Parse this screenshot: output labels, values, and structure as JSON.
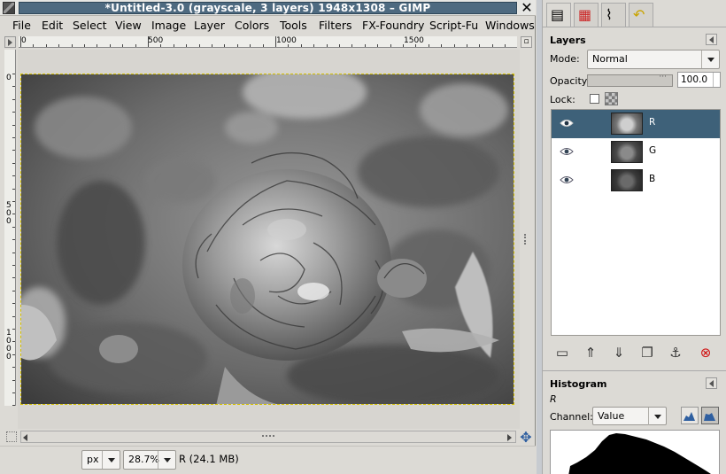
{
  "window": {
    "title": "*Untitled-3.0 (grayscale, 3 layers) 1948x1308 – GIMP",
    "close_glyph": "✕"
  },
  "menubar": {
    "items": [
      "File",
      "Edit",
      "Select",
      "View",
      "Image",
      "Layer",
      "Colors",
      "Tools",
      "Filters",
      "FX-Foundry",
      "Script-Fu",
      "Windows"
    ]
  },
  "rulers": {
    "horizontal_labels": [
      "0",
      "500",
      "1000",
      "1500"
    ],
    "vertical_labels": [
      "0",
      "5\n0\n0",
      "1\n0\n0\n0"
    ]
  },
  "statusbar": {
    "unit": "px",
    "zoom": "28.7%",
    "info": "R (24.1 MB)"
  },
  "dock": {
    "layers_title": "Layers",
    "mode_label": "Mode:",
    "mode_value": "Normal",
    "opacity_label": "Opacity:",
    "opacity_value": "100.0",
    "opacity_fraction": 1.0,
    "lock_label": "Lock:",
    "layers": [
      {
        "name": "R",
        "selected": true
      },
      {
        "name": "G",
        "selected": false
      },
      {
        "name": "B",
        "selected": false
      }
    ],
    "histogram_title": "Histogram",
    "histogram_channel_name": "R",
    "channel_label": "Channel:",
    "channel_value": "Value"
  },
  "icons": {
    "tab_layers": "layers-icon",
    "tab_channels": "channels-icon",
    "tab_paths": "paths-icon",
    "tab_undo": "undo-icon"
  },
  "colors": {
    "title_bar": "#4e6a80",
    "selected_row": "#3e6179",
    "delete_red": "#d01010"
  }
}
